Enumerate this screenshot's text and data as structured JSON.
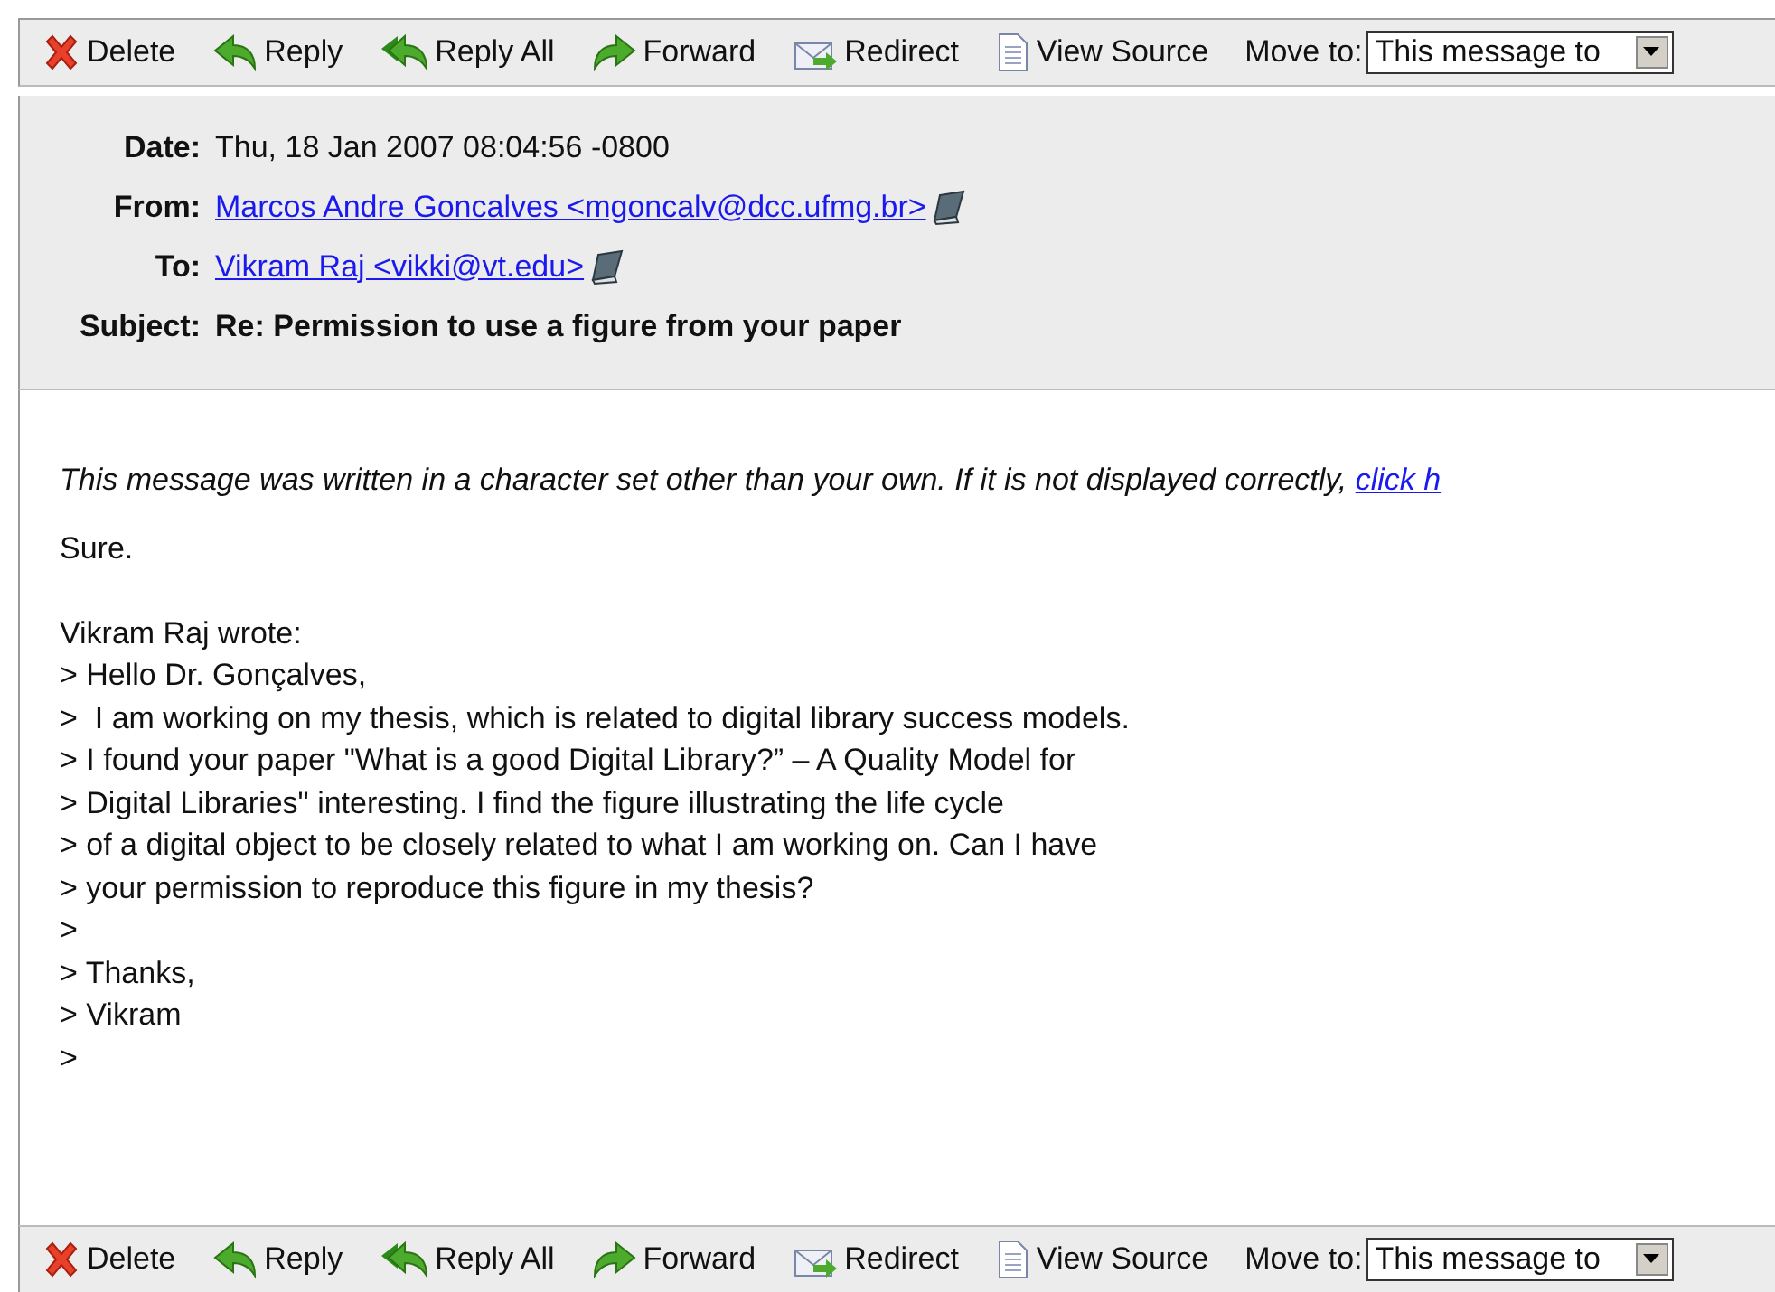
{
  "toolbar_top": {
    "buttons": [
      {
        "kind": "delete",
        "label": "Delete"
      },
      {
        "kind": "reply",
        "label": "Reply"
      },
      {
        "kind": "reply_all",
        "label": "Reply All"
      },
      {
        "kind": "forward",
        "label": "Forward"
      },
      {
        "kind": "redirect",
        "label": "Redirect"
      },
      {
        "kind": "source",
        "label": "View Source"
      }
    ],
    "move_label": "Move to:",
    "move_value": "This message to"
  },
  "header": [
    {
      "label": "Date:",
      "kind": "text",
      "value": "Thu, 18 Jan 2007 08:04:56 -0800"
    },
    {
      "label": "From:",
      "kind": "address",
      "value": "Marcos Andre Goncalves <mgoncalv@dcc.ufmg.br>"
    },
    {
      "label": "To:",
      "kind": "address",
      "value": "Vikram Raj <vikki@vt.edu>"
    },
    {
      "label": "Subject:",
      "kind": "subject",
      "value": "Re: Permission to use a figure from your paper"
    }
  ],
  "notice": {
    "text": "This message was written in a character set other than your own. If it is not displayed correctly,",
    "link": "click h"
  },
  "paragraphs": [
    [
      "Sure."
    ],
    [
      "Vikram Raj wrote:",
      "> Hello Dr. Gonçalves,",
      ">  I am working on my thesis, which is related to digital library success models.",
      "> I found your paper \"What is a good Digital Library?” – A Quality Model for",
      "> Digital Libraries\" interesting. I find the figure illustrating the life cycle",
      "> of a digital object to be closely related to what I am working on. Can I have",
      "> your permission to reproduce this figure in my thesis?",
      ">",
      "> Thanks,",
      "> Vikram",
      ">"
    ]
  ],
  "toolbar_bottom": {
    "buttons": [
      {
        "kind": "delete",
        "label": "Delete"
      },
      {
        "kind": "reply",
        "label": "Reply"
      },
      {
        "kind": "reply_all",
        "label": "Reply All"
      },
      {
        "kind": "forward",
        "label": "Forward"
      },
      {
        "kind": "redirect",
        "label": "Redirect"
      },
      {
        "kind": "source",
        "label": "View Source"
      }
    ],
    "move_label": "Move to:",
    "move_value": "This message to"
  }
}
